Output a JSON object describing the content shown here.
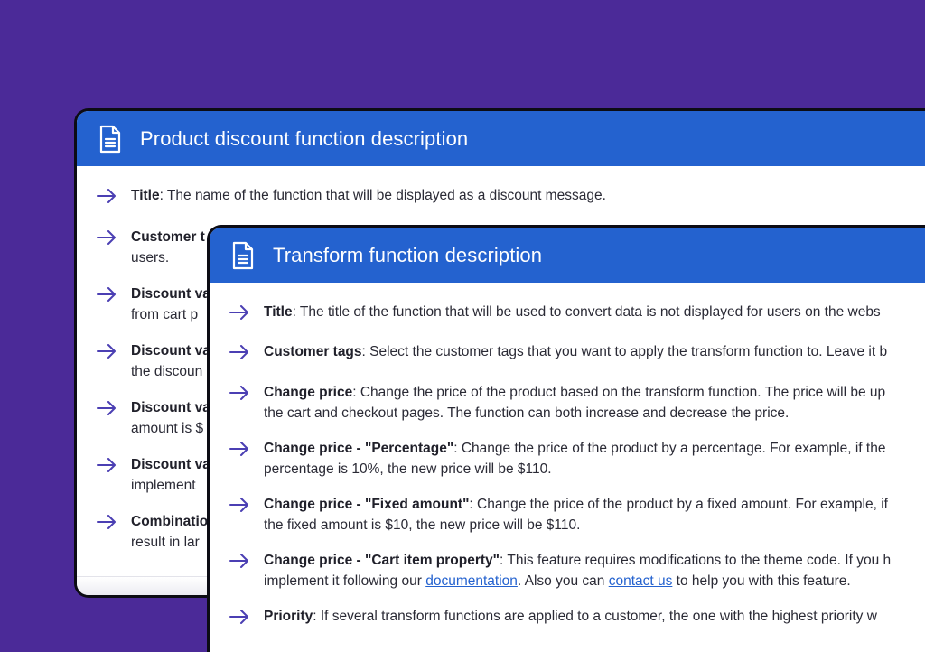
{
  "colors": {
    "background": "#4b2a98",
    "header": "#2462cf",
    "arrow": "#4b3fb3",
    "link": "#2462cf"
  },
  "card1": {
    "title": "Product discount function description",
    "icon": "document-icon",
    "items": [
      {
        "label": "Title",
        "text": ": The name of the function that will be displayed as a discount message."
      },
      {
        "label": "Customer t",
        "line2": "users."
      },
      {
        "label": "Discount va",
        "line2": "from cart p"
      },
      {
        "label": "Discount va",
        "line2": "the discoun"
      },
      {
        "label": "Discount va",
        "line2": "amount is $"
      },
      {
        "label": "Discount va",
        "line2": "implement"
      },
      {
        "label": "Combinatio",
        "line2": "result in lar"
      }
    ]
  },
  "card2": {
    "title": "Transform function description",
    "icon": "document-icon",
    "items": [
      {
        "label": "Title",
        "text": ": The title of the function that will be used to convert data is not displayed for users on the webs"
      },
      {
        "label": "Customer tags",
        "text": ": Select the customer tags that you want to apply the transform function to. Leave it b"
      },
      {
        "label": "Change price",
        "text": ": Change the price of the product based on the transform function. The price will be up",
        "line2": "the cart and checkout pages. The function can both increase and decrease the price."
      },
      {
        "label": "Change price - \"Percentage\"",
        "text": ": Change the price of the product by a percentage. For example, if the",
        "line2": "percentage is 10%, the new price will be $110."
      },
      {
        "label": "Change price - \"Fixed amount\"",
        "text": ": Change the price of the product by a fixed amount. For example, if",
        "line2": "the fixed amount is $10, the new price will be $110."
      },
      {
        "label": "Change price - \"Cart item property\"",
        "text": ": This feature requires modifications to the theme code. If you h",
        "line2_pre": "implement it following our ",
        "link1": "documentation",
        "line2_mid": ". Also you can ",
        "link2": "contact us",
        "line2_post": " to help you with this feature."
      },
      {
        "label": "Priority",
        "text": ": If several transform functions are applied to a customer, the one with the highest priority w"
      }
    ]
  }
}
